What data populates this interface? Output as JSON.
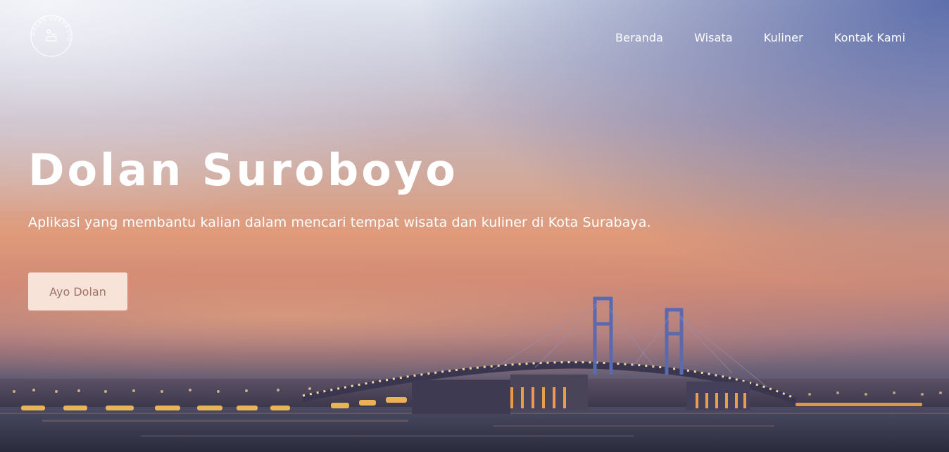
{
  "brand": {
    "logo_text": "DOLAN SUROBOYO"
  },
  "nav": {
    "items": [
      {
        "label": "Beranda"
      },
      {
        "label": "Wisata"
      },
      {
        "label": "Kuliner"
      },
      {
        "label": "Kontak Kami"
      }
    ]
  },
  "hero": {
    "title": "Dolan Suroboyo",
    "subtitle": "Aplikasi yang membantu kalian dalam mencari tempat wisata dan kuliner di Kota Surabaya.",
    "cta_label": "Ayo Dolan",
    "background_image": "suramadu-bridge-sunset"
  },
  "colors": {
    "text": "#ffffff",
    "button_bg": "#fae8de",
    "button_text": "#a07468"
  }
}
